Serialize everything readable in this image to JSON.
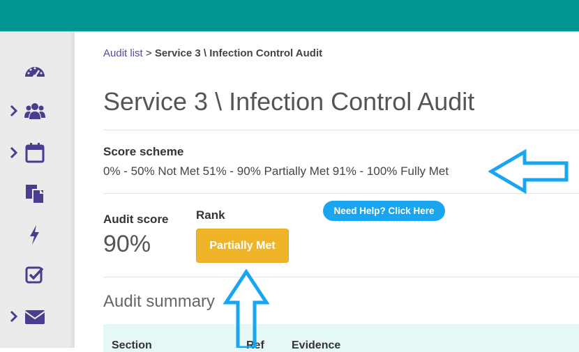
{
  "breadcrumb": {
    "link": "Audit list",
    "separator": ">",
    "current": "Service 3 \\ Infection Control Audit"
  },
  "page_title": "Service 3 \\ Infection Control Audit",
  "score_scheme": {
    "label": "Score scheme",
    "text": "0% - 50% Not Met 51% - 90% Partially Met 91% - 100% Fully Met"
  },
  "audit_score": {
    "label": "Audit score",
    "value": "90%"
  },
  "rank": {
    "label": "Rank",
    "value": "Partially Met",
    "color": "#f0b429"
  },
  "help_button": {
    "label": "Need Help? Click Here",
    "color": "#1aa5f0"
  },
  "audit_summary": {
    "title": "Audit summary",
    "columns": [
      "Section",
      "Ref",
      "Evidence"
    ]
  },
  "sidebar": {
    "items": [
      {
        "icon": "dashboard-icon",
        "expandable": false
      },
      {
        "icon": "users-icon",
        "expandable": true
      },
      {
        "icon": "calendar-icon",
        "expandable": true
      },
      {
        "icon": "documents-icon",
        "expandable": false
      },
      {
        "icon": "lightning-icon",
        "expandable": false
      },
      {
        "icon": "checkbox-icon",
        "expandable": false
      },
      {
        "icon": "envelope-icon",
        "expandable": true
      }
    ]
  },
  "colors": {
    "topbar": "#00968f",
    "sidebar_icons": "#4a3d8f",
    "annotation_arrows": "#1aa5f0"
  }
}
